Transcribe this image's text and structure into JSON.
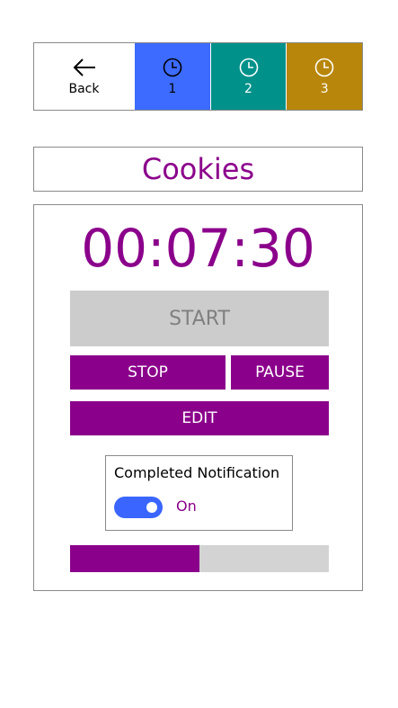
{
  "nav": {
    "back_label": "Back",
    "tabs": [
      {
        "label": "1",
        "color": "#3d6bff"
      },
      {
        "label": "2",
        "color": "#00918a"
      },
      {
        "label": "3",
        "color": "#b8860b"
      }
    ]
  },
  "timer": {
    "name": "Cookies",
    "time": "00:07:30",
    "start_label": "START",
    "stop_label": "STOP",
    "pause_label": "PAUSE",
    "edit_label": "EDIT",
    "notification_label": "Completed Notification",
    "notification_state": "On",
    "progress_fraction": 0.5
  },
  "colors": {
    "accent": "#8b008b",
    "toggle": "#3a66ff",
    "disabled": "#cccccc"
  },
  "icons": {
    "back": "arrow-left-icon",
    "tab": "clock-icon"
  }
}
